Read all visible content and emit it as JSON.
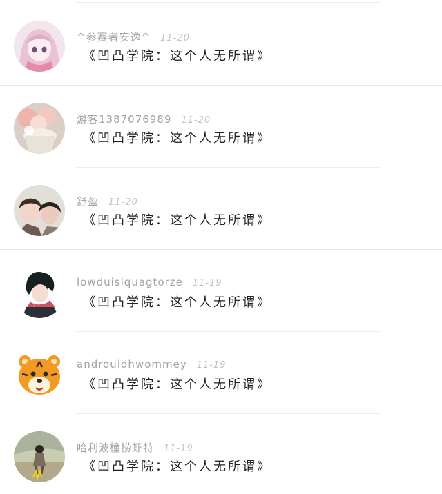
{
  "comments": [
    {
      "username": "^参赛者安逸^",
      "date": "11-20",
      "text": "《凹凸学院：这个人无所谓》",
      "avatar": "anime-girl-pink-hair-avatar"
    },
    {
      "username": "游客1387076989",
      "date": "11-20",
      "text": "《凹凸学院：这个人无所谓》",
      "avatar": "cupcake-flower-avatar"
    },
    {
      "username": "舒盈",
      "date": "11-20",
      "text": "《凹凸学院：这个人无所谓》",
      "avatar": "two-girls-photo-avatar"
    },
    {
      "username": "lowduislquagtorze",
      "date": "11-19",
      "text": "《凹凸学院：这个人无所谓》",
      "avatar": "anime-boy-scarf-avatar"
    },
    {
      "username": "androuidhwommey",
      "date": "11-19",
      "text": "《凹凸学院：这个人无所谓》",
      "avatar": "cartoon-tiger-avatar"
    },
    {
      "username": "哈利波橦捞虾特",
      "date": "11-19",
      "text": "《凹凸学院：这个人无所谓》",
      "avatar": "girl-standing-photo-avatar"
    }
  ]
}
